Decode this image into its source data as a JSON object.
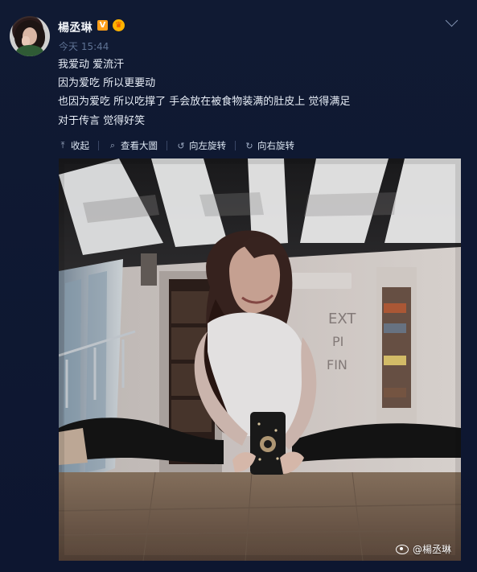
{
  "header": {
    "username": "楊丞琳",
    "verify_badge": "V",
    "crown_badge": "♛",
    "timestamp": "今天 15:44"
  },
  "post": {
    "lines": [
      "我爱动 爱流汗",
      "因为爱吃 所以更要动",
      "也因为爱吃 所以吃撑了 手会放在被食物装满的肚皮上 觉得满足",
      "对于传言 觉得好笑"
    ]
  },
  "actions": [
    {
      "label": "收起",
      "icon": "collapse-icon"
    },
    {
      "label": "查看大圖",
      "icon": "search-icon"
    },
    {
      "label": "向左旋转",
      "icon": "rotate-left-icon"
    },
    {
      "label": "向右旋转",
      "icon": "rotate-right-icon"
    }
  ],
  "photo": {
    "watermark": "@楊丞琳"
  },
  "colors": {
    "background": "#0f1830",
    "text": "#e7edf6",
    "muted": "#5f7394",
    "accent": "#ff9f1a"
  }
}
